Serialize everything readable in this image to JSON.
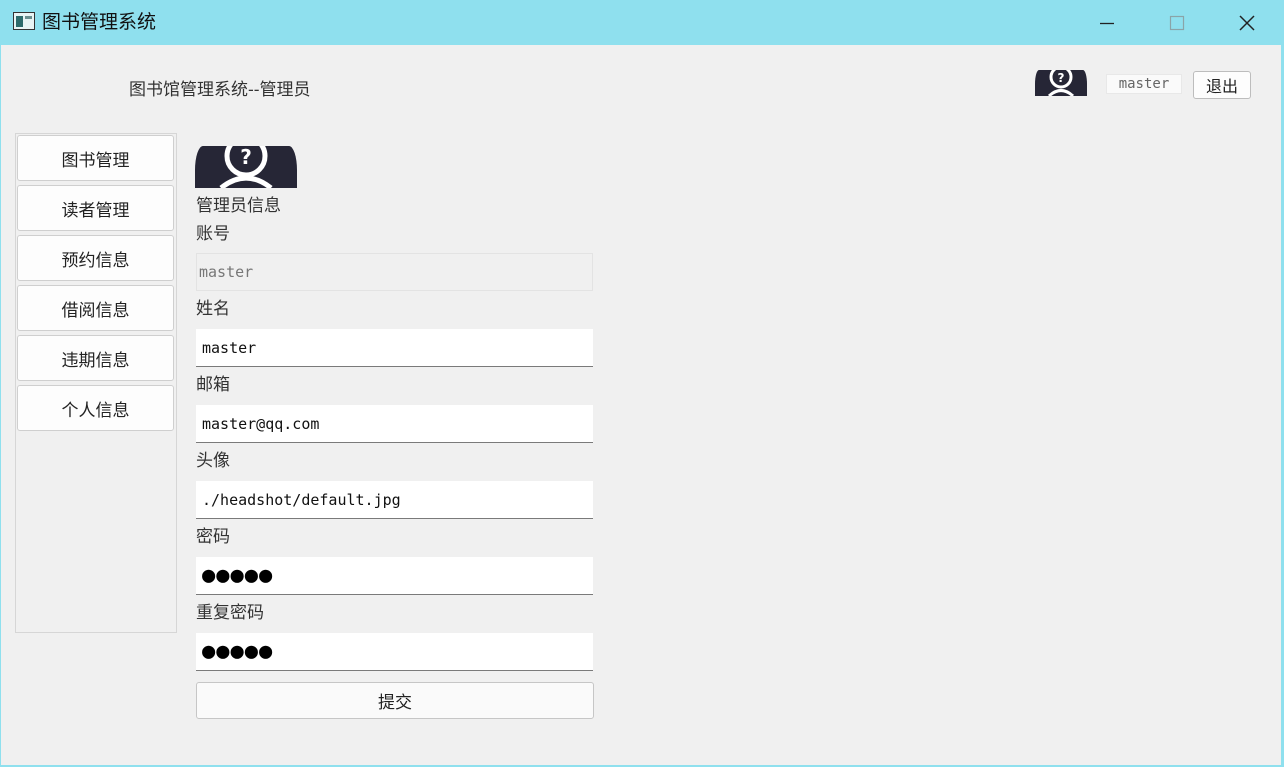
{
  "window": {
    "title": "图书管理系统"
  },
  "header": {
    "title": "图书馆管理系统--管理员",
    "username": "master",
    "logout_label": "退出"
  },
  "sidebar": {
    "items": [
      {
        "label": "图书管理"
      },
      {
        "label": "读者管理"
      },
      {
        "label": "预约信息"
      },
      {
        "label": "借阅信息"
      },
      {
        "label": "违期信息"
      },
      {
        "label": "个人信息"
      }
    ]
  },
  "profile": {
    "section_title": "管理员信息",
    "account_label": "账号",
    "account_value": "master",
    "name_label": "姓名",
    "name_value": "master",
    "email_label": "邮箱",
    "email_value": "master@qq.com",
    "avatar_label": "头像",
    "avatar_value": "./headshot/default.jpg",
    "password_label": "密码",
    "password_value": "●●●●●",
    "repeat_password_label": "重复密码",
    "repeat_password_value": "●●●●●",
    "submit_label": "提交"
  },
  "colors": {
    "titlebar": "#8fe0ee",
    "client_bg": "#f0f0f0",
    "avatar": "#262636"
  }
}
